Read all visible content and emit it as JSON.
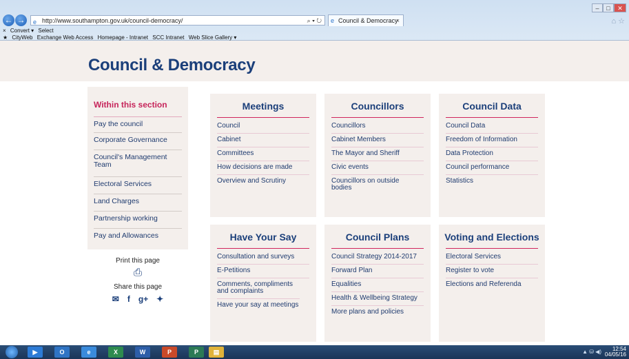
{
  "browser": {
    "url": "http://www.southampton.gov.uk/council-democracy/",
    "tab_title": "Council & Democracy",
    "tab_close": "×",
    "address_tools": "⌕ ▾ ↻",
    "command_bar": [
      "Convert ▾",
      "Select"
    ],
    "favorites": [
      "CityWeb",
      "Exchange Web Access",
      "Homepage - Intranet",
      "SCC Intranet",
      "Web Slice Gallery ▾"
    ],
    "window_controls": [
      "–",
      "□",
      "✕"
    ]
  },
  "page": {
    "title": "Council & Democracy"
  },
  "sidebar": {
    "heading": "Within this section",
    "items": [
      "Pay the council",
      "Corporate Governance",
      "Council's Management Team",
      "Electoral Services",
      "Land Charges",
      "Partnership working",
      "Pay and Allowances"
    ]
  },
  "utility": {
    "print_label": "Print this page",
    "share_label": "Share this page",
    "print_icon": "printer-icon",
    "share_icons": [
      "email-icon",
      "facebook-icon",
      "google-plus-icon",
      "twitter-icon"
    ]
  },
  "cards": [
    {
      "title": "Meetings",
      "links": [
        "Council",
        "Cabinet",
        "Committees",
        "How decisions are made",
        "Overview and Scrutiny"
      ]
    },
    {
      "title": "Councillors",
      "links": [
        "Councillors",
        "Cabinet Members",
        "The Mayor and Sheriff",
        "Civic events",
        "Councillors on outside bodies"
      ]
    },
    {
      "title": "Council Data",
      "links": [
        "Council Data",
        "Freedom of Information",
        "Data Protection",
        "Council performance",
        "Statistics"
      ]
    },
    {
      "title": "Have Your Say",
      "links": [
        "Consultation and surveys",
        "E-Petitions",
        "Comments, compliments and complaints",
        "Have your say at meetings"
      ]
    },
    {
      "title": "Council Plans",
      "links": [
        "Council Strategy 2014-2017",
        "Forward Plan",
        "Equalities",
        "Health & Wellbeing Strategy",
        "More plans and policies"
      ]
    },
    {
      "title": "Voting and Elections",
      "links": [
        "Electoral Services",
        "Register to vote",
        "Elections and Referenda"
      ]
    }
  ],
  "taskbar": {
    "time": "12:54",
    "date": "04/05/16",
    "apps": [
      "Media Player",
      "Outlook",
      "Internet Explorer",
      "Excel",
      "Word",
      "PowerPoint",
      "Project",
      "Explorer"
    ],
    "app_labels": [
      "▶",
      "O",
      "e",
      "X",
      "W",
      "P",
      "P",
      "▤"
    ]
  },
  "colors": {
    "accent": "#c6245a",
    "navy": "#1b3f7a",
    "panel": "#f4efec"
  }
}
